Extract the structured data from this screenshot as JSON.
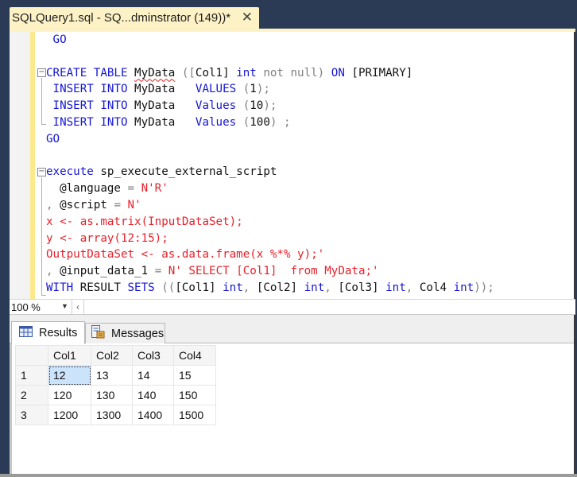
{
  "window": {
    "tab_title": "SQLQuery1.sql - SQ...dminstrator (149))*",
    "close_icon": "close-icon"
  },
  "editor": {
    "lines": [
      [
        {
          "t": " GO",
          "c": "kw"
        }
      ],
      [
        {
          "t": "",
          "c": "def"
        }
      ],
      [
        {
          "t": "CREATE TABLE ",
          "c": "kw"
        },
        {
          "t": "MyData",
          "c": "def squiggle"
        },
        {
          "t": " ([",
          "c": "gray"
        },
        {
          "t": "Col1",
          "c": "def"
        },
        {
          "t": "] ",
          "c": "def"
        },
        {
          "t": "int",
          "c": "kw"
        },
        {
          "t": " not null) ",
          "c": "gray"
        },
        {
          "t": "ON",
          "c": "kw"
        },
        {
          "t": " [PRIMARY]",
          "c": "def"
        }
      ],
      [
        {
          "t": " INSERT INTO ",
          "c": "kw"
        },
        {
          "t": "MyData",
          "c": "def"
        },
        {
          "t": "   VALUES ",
          "c": "kw"
        },
        {
          "t": "(",
          "c": "gray"
        },
        {
          "t": "1",
          "c": "def"
        },
        {
          "t": ");",
          "c": "gray"
        }
      ],
      [
        {
          "t": " INSERT INTO ",
          "c": "kw"
        },
        {
          "t": "MyData",
          "c": "def"
        },
        {
          "t": "   Values ",
          "c": "kw"
        },
        {
          "t": "(",
          "c": "gray"
        },
        {
          "t": "10",
          "c": "def"
        },
        {
          "t": ");",
          "c": "gray"
        }
      ],
      [
        {
          "t": " INSERT INTO ",
          "c": "kw"
        },
        {
          "t": "MyData",
          "c": "def"
        },
        {
          "t": "   Values ",
          "c": "kw"
        },
        {
          "t": "(",
          "c": "gray"
        },
        {
          "t": "100",
          "c": "def"
        },
        {
          "t": ") ;",
          "c": "gray"
        }
      ],
      [
        {
          "t": "GO",
          "c": "kw"
        }
      ],
      [
        {
          "t": "",
          "c": "def"
        }
      ],
      [
        {
          "t": "execute",
          "c": "kw"
        },
        {
          "t": " sp_execute_external_script",
          "c": "def"
        }
      ],
      [
        {
          "t": "  @language ",
          "c": "def"
        },
        {
          "t": "=",
          "c": "gray"
        },
        {
          "t": " N'R'",
          "c": "str"
        }
      ],
      [
        {
          "t": ", ",
          "c": "gray"
        },
        {
          "t": "@script ",
          "c": "def"
        },
        {
          "t": "=",
          "c": "gray"
        },
        {
          "t": " N'",
          "c": "str"
        }
      ],
      [
        {
          "t": "x <- as.matrix(InputDataSet);",
          "c": "str"
        }
      ],
      [
        {
          "t": "y <- array(12:15);",
          "c": "str"
        }
      ],
      [
        {
          "t": "OutputDataSet <- as.data.frame(x %*% y);'",
          "c": "str"
        }
      ],
      [
        {
          "t": ", ",
          "c": "gray"
        },
        {
          "t": "@input_data_1 ",
          "c": "def"
        },
        {
          "t": "=",
          "c": "gray"
        },
        {
          "t": " N' SELECT [Col1]  from MyData;'",
          "c": "str"
        }
      ],
      [
        {
          "t": "WITH",
          "c": "kw"
        },
        {
          "t": " RESULT ",
          "c": "def"
        },
        {
          "t": "SETS",
          "c": "kw"
        },
        {
          "t": " ((",
          "c": "gray"
        },
        {
          "t": "[Col1] ",
          "c": "def"
        },
        {
          "t": "int",
          "c": "kw"
        },
        {
          "t": ", ",
          "c": "gray"
        },
        {
          "t": "[Col2] ",
          "c": "def"
        },
        {
          "t": "int",
          "c": "kw"
        },
        {
          "t": ", ",
          "c": "gray"
        },
        {
          "t": "[Col3] ",
          "c": "def"
        },
        {
          "t": "int",
          "c": "kw"
        },
        {
          "t": ", ",
          "c": "gray"
        },
        {
          "t": "Col4 ",
          "c": "def"
        },
        {
          "t": "int",
          "c": "kw"
        },
        {
          "t": "));",
          "c": "gray"
        }
      ]
    ]
  },
  "status": {
    "zoom_level": "100 %"
  },
  "results_tabs": [
    {
      "label": "Results",
      "icon": "grid-icon",
      "active": true
    },
    {
      "label": "Messages",
      "icon": "messages-icon",
      "active": false
    }
  ],
  "results": {
    "columns": [
      "Col1",
      "Col2",
      "Col3",
      "Col4"
    ],
    "rows": [
      {
        "num": "1",
        "cells": [
          "12",
          "13",
          "14",
          "15"
        ]
      },
      {
        "num": "2",
        "cells": [
          "120",
          "130",
          "140",
          "150"
        ]
      },
      {
        "num": "3",
        "cells": [
          "1200",
          "1300",
          "1400",
          "1500"
        ]
      }
    ],
    "selected_cell": {
      "row": 0,
      "col": 0
    }
  },
  "colors": {
    "keyword": "#1515d6",
    "string": "#e8202a",
    "operator": "#808080",
    "tab_active": "#fdf2c5",
    "frame": "#2b3a55"
  }
}
